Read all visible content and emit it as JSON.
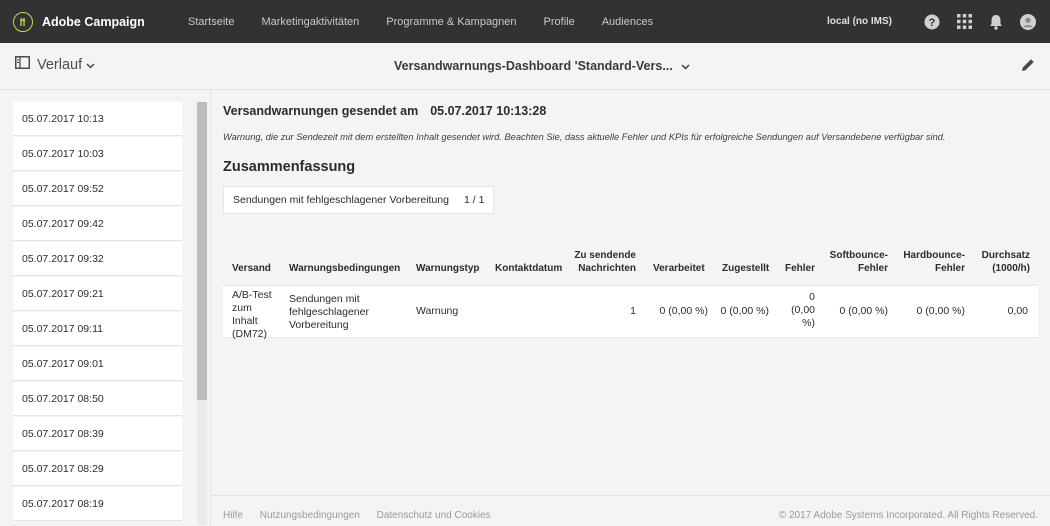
{
  "app": {
    "brand": "Adobe Campaign",
    "nav": [
      "Startseite",
      "Marketingaktivitäten",
      "Programme & Kampagnen",
      "Profile",
      "Audiences"
    ],
    "instance": "local (no IMS)"
  },
  "subheader": {
    "history_label": "Verlauf",
    "title": "Versandwarnungs-Dashboard 'Standard-Vers..."
  },
  "history": [
    "05.07.2017 10:13",
    "05.07.2017 10:03",
    "05.07.2017 09:52",
    "05.07.2017 09:42",
    "05.07.2017 09:32",
    "05.07.2017 09:21",
    "05.07.2017 09:11",
    "05.07.2017 09:01",
    "05.07.2017 08:50",
    "05.07.2017 08:39",
    "05.07.2017 08:29",
    "05.07.2017 08:19"
  ],
  "main": {
    "sent_label": "Versandwarnungen gesendet am",
    "sent_datetime": "05.07.2017 10:13:28",
    "note": "Warnung, die zur Sendezeit mit dem erstellten Inhalt gesendet wird. Beachten Sie, dass aktuelle Fehler und KPIs für erfolgreiche Sendungen auf Versandebene verfügbar sind.",
    "summary_title": "Zusammenfassung",
    "summary_chip": {
      "label": "Sendungen mit fehlgeschlagener Vorbereitung",
      "count": "1 / 1"
    },
    "table": {
      "headers": {
        "versand": "Versand",
        "bedingungen": "Warnungsbedingungen",
        "typ": "Warnungstyp",
        "kontakt": "Kontaktdatum",
        "zu_senden": "Zu sendende Nachrichten",
        "verarbeitet": "Verarbeitet",
        "zugestellt": "Zugestellt",
        "fehler": "Fehler",
        "softbounce": "Softbounce-Fehler",
        "hardbounce": "Hardbounce-Fehler",
        "durchsatz": "Durchsatz (1000/h)"
      },
      "rows": [
        {
          "versand": "A/B-Test zum Inhalt (DM72)",
          "bedingungen": "Sendungen mit fehlgeschlagener Vorbereitung",
          "typ": "Warnung",
          "kontakt": "",
          "zu_senden": "1",
          "verarbeitet": "0 (0,00 %)",
          "zugestellt": "0 (0,00 %)",
          "fehler": "0 (0,00 %)",
          "softbounce": "0 (0,00 %)",
          "hardbounce": "0 (0,00 %)",
          "durchsatz": "0,00"
        }
      ]
    }
  },
  "footer": {
    "links": [
      "Hilfe",
      "Nutzungsbedingungen",
      "Datenschutz und Cookies"
    ],
    "copyright": "© 2017 Adobe Systems Incorporated. All Rights Reserved."
  },
  "icons": [
    "adobe-campaign-logo-icon",
    "help-icon",
    "apps-grid-icon",
    "bell-icon",
    "user-avatar-icon",
    "sidebar-toggle-icon",
    "chevron-down-icon",
    "pencil-icon"
  ],
  "colors": {
    "topbar": "#323232",
    "accent_logo": "#c8d84a",
    "background": "#f4f4f4"
  }
}
